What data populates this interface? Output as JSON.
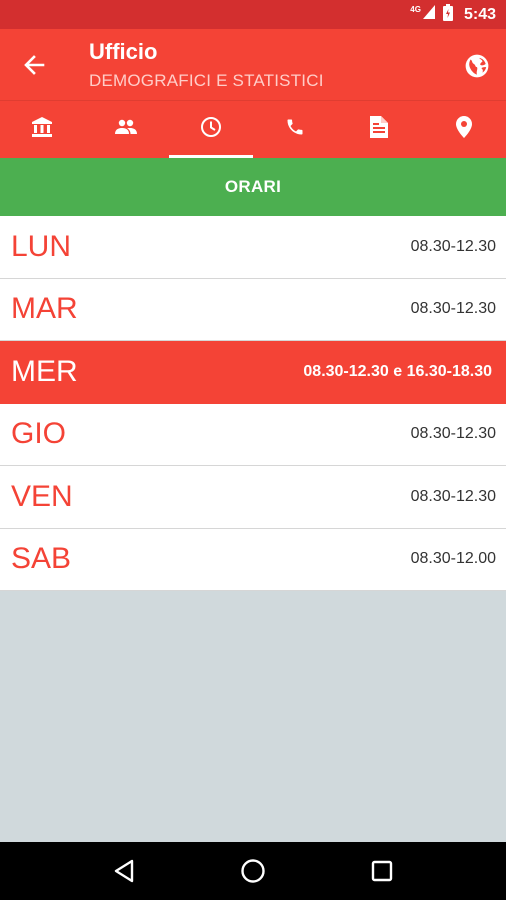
{
  "status_bar": {
    "network": "4G",
    "time": "5:43"
  },
  "app_bar": {
    "title": "Ufficio",
    "subtitle": "DEMOGRAFICI E STATISTICI",
    "back_icon": "arrow-back-icon",
    "globe_icon": "globe-icon"
  },
  "tabs": [
    {
      "icon": "bank-icon",
      "active": false
    },
    {
      "icon": "people-icon",
      "active": false
    },
    {
      "icon": "clock-icon",
      "active": true
    },
    {
      "icon": "phone-icon",
      "active": false
    },
    {
      "icon": "document-icon",
      "active": false
    },
    {
      "icon": "location-pin-icon",
      "active": false
    }
  ],
  "section": {
    "title": "ORARI"
  },
  "schedule": [
    {
      "day": "LUN",
      "hours": "08.30-12.30",
      "highlight": false
    },
    {
      "day": "MAR",
      "hours": "08.30-12.30",
      "highlight": false
    },
    {
      "day": "MER",
      "hours": "08.30-12.30 e 16.30-18.30",
      "highlight": true
    },
    {
      "day": "GIO",
      "hours": "08.30-12.30",
      "highlight": false
    },
    {
      "day": "VEN",
      "hours": "08.30-12.30",
      "highlight": false
    },
    {
      "day": "SAB",
      "hours": "08.30-12.00",
      "highlight": false
    }
  ],
  "colors": {
    "primary": "#f44336",
    "primary_dark": "#d32f2f",
    "section_green": "#4caf50",
    "background": "#d0d9dc"
  },
  "nav_bar": {
    "back": "nav-back-icon",
    "home": "nav-home-icon",
    "recents": "nav-recents-icon"
  }
}
